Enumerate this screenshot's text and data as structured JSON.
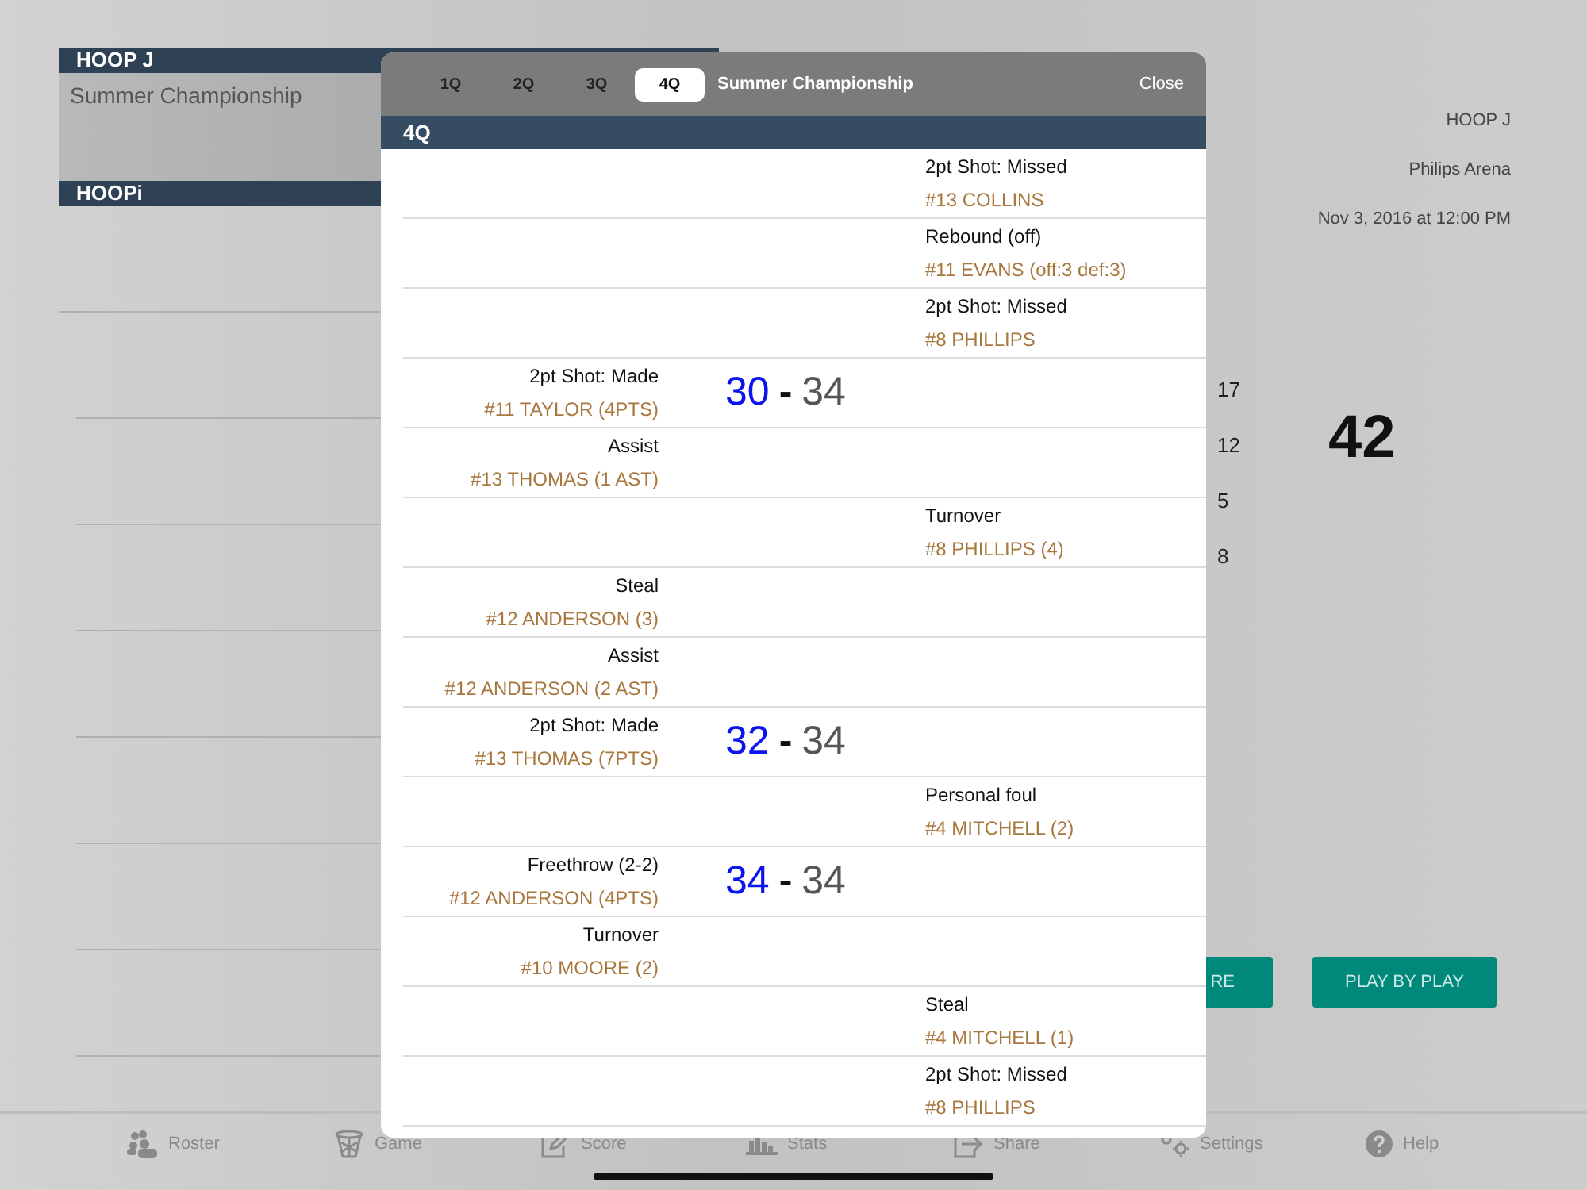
{
  "background": {
    "team_header": "HOOP J",
    "event_name": "Summer Championship",
    "team_header_2": "HOOPi",
    "info": [
      "HOOP J",
      "Philips Arena",
      "Nov 3, 2016 at 12:00 PM"
    ],
    "player_stats": [
      "17",
      "12",
      "5",
      "8"
    ],
    "total": "42",
    "buttons": [
      {
        "label": "RE"
      },
      {
        "label": "PLAY BY PLAY"
      }
    ]
  },
  "tab_bar": [
    {
      "label": "Roster"
    },
    {
      "label": "Game"
    },
    {
      "label": "Score"
    },
    {
      "label": "Stats"
    },
    {
      "label": "Share"
    },
    {
      "label": "Settings"
    },
    {
      "label": "Help"
    }
  ],
  "modal": {
    "quarters": [
      {
        "label": "1Q",
        "selected": false
      },
      {
        "label": "2Q",
        "selected": false
      },
      {
        "label": "3Q",
        "selected": false
      },
      {
        "label": "4Q",
        "selected": true
      }
    ],
    "title": "Summer Championship",
    "close": "Close",
    "section": "4Q",
    "plays": [
      {
        "kind": "away",
        "action": "2pt Shot: Missed",
        "player": "#13 COLLINS"
      },
      {
        "kind": "away",
        "action": "Rebound (off)",
        "player": "#11 EVANS (off:3 def:3)"
      },
      {
        "kind": "away",
        "action": "2pt Shot: Missed",
        "player": "#8 PHILLIPS"
      },
      {
        "kind": "home",
        "action": "2pt Shot: Made",
        "player": "#11 TAYLOR (4PTS)",
        "score": {
          "home": "30",
          "sep": "-",
          "away": "34"
        }
      },
      {
        "kind": "home",
        "action": "Assist",
        "player": "#13 THOMAS (1 AST)"
      },
      {
        "kind": "away",
        "action": "Turnover",
        "player": "#8 PHILLIPS (4)"
      },
      {
        "kind": "home",
        "action": "Steal",
        "player": "#12 ANDERSON (3)"
      },
      {
        "kind": "home",
        "action": "Assist",
        "player": "#12 ANDERSON (2 AST)"
      },
      {
        "kind": "home",
        "action": "2pt Shot: Made",
        "player": "#13 THOMAS (7PTS)",
        "score": {
          "home": "32",
          "sep": "-",
          "away": "34"
        }
      },
      {
        "kind": "away",
        "action": "Personal foul",
        "player": "#4 MITCHELL (2)"
      },
      {
        "kind": "home",
        "action": "Freethrow (2-2)",
        "player": "#12 ANDERSON (4PTS)",
        "score": {
          "home": "34",
          "sep": "-",
          "away": "34"
        }
      },
      {
        "kind": "home",
        "action": "Turnover",
        "player": "#10 MOORE (2)"
      },
      {
        "kind": "away",
        "action": "Steal",
        "player": "#4 MITCHELL (1)"
      },
      {
        "kind": "away",
        "action": "2pt Shot: Missed",
        "player": "#8 PHILLIPS"
      }
    ]
  }
}
